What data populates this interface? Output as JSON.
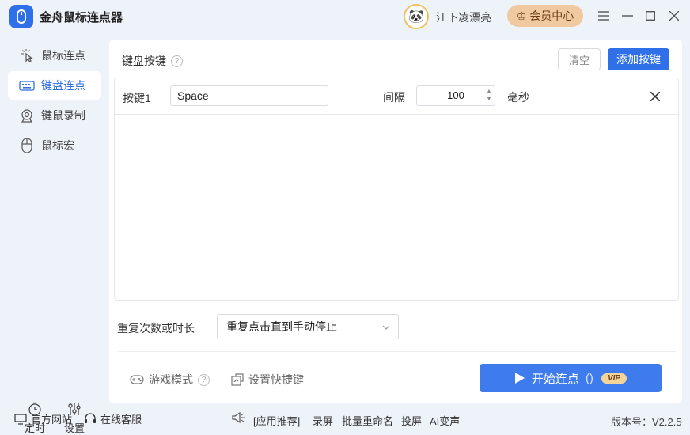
{
  "app": {
    "title": "金舟鼠标连点器"
  },
  "user": {
    "name": "江下凌漂亮"
  },
  "header": {
    "vip_center": "会员中心"
  },
  "sidebar": {
    "items": [
      {
        "label": "鼠标连点",
        "icon": "mouse-click-icon"
      },
      {
        "label": "键盘连点",
        "icon": "keyboard-icon"
      },
      {
        "label": "键鼠录制",
        "icon": "record-icon"
      },
      {
        "label": "鼠标宏",
        "icon": "mouse-icon"
      }
    ],
    "bottom": [
      {
        "label": "定时",
        "icon": "timer-icon"
      },
      {
        "label": "设置",
        "icon": "settings-sliders-icon"
      }
    ]
  },
  "main": {
    "title": "键盘按键",
    "clear_label": "清空",
    "add_label": "添加按键",
    "rows": [
      {
        "label": "按键1",
        "key": "Space",
        "interval_label": "间隔",
        "interval": "100",
        "unit": "毫秒"
      }
    ],
    "repeat_label": "重复次数或时长",
    "repeat_value": "重复点击直到手动停止",
    "game_mode": "游戏模式",
    "shortcut": "设置快捷键",
    "start_label": "开始连点",
    "start_hotkey": "()",
    "vip_tag": "VIP"
  },
  "statusbar": {
    "website": "官方网站",
    "service": "在线客服",
    "recommend": "[应用推荐]",
    "links": [
      "录屏",
      "批量重命名",
      "投屏",
      "AI变声"
    ],
    "version": "版本号：V2.2.5"
  },
  "colors": {
    "accent": "#2f6fe8",
    "vip": "#f0c9a0",
    "background": "#eef2f9"
  }
}
